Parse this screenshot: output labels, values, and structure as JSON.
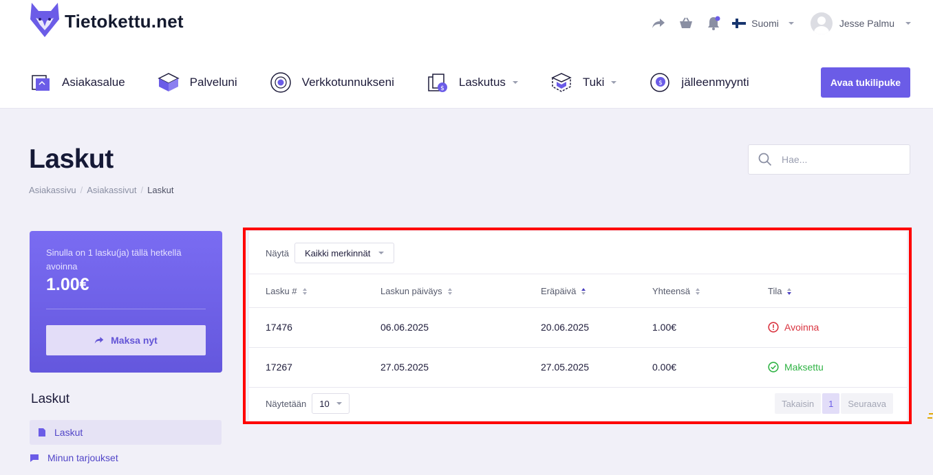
{
  "brand": {
    "name": "Tietokettu.net",
    "accent": "#6b5ce7"
  },
  "top_right": {
    "share_icon": "share-arrow-icon",
    "basket_icon": "basket-icon",
    "bell_icon": "bell-icon",
    "language": "Suomi",
    "user_name": "Jesse Palmu"
  },
  "nav": {
    "items": [
      {
        "label": "Asiakasalue",
        "icon": "client-area-icon",
        "dropdown": false
      },
      {
        "label": "Palveluni",
        "icon": "services-box-icon",
        "dropdown": false
      },
      {
        "label": "Verkkotunnukseni",
        "icon": "domains-globe-icon",
        "dropdown": false
      },
      {
        "label": "Laskutus",
        "icon": "billing-icon",
        "dropdown": true
      },
      {
        "label": "Tuki",
        "icon": "support-box-icon",
        "dropdown": true
      },
      {
        "label": "jälleenmyynti",
        "icon": "reseller-icon",
        "dropdown": false
      }
    ],
    "ticket_button": "Avaa tukilipuke"
  },
  "page": {
    "title": "Laskut",
    "breadcrumb": [
      "Asiakassivu",
      "Asiakassivut",
      "Laskut"
    ],
    "search_placeholder": "Hae..."
  },
  "due_card": {
    "text": "Sinulla on 1 lasku(ja) tällä hetkellä avoinna",
    "amount": "1.00€",
    "pay_button": "Maksa nyt"
  },
  "sidebar": {
    "heading": "Laskut",
    "links": [
      {
        "label": "Laskut",
        "icon": "document-icon",
        "active": true
      },
      {
        "label": "Minun tarjoukset",
        "icon": "chat-icon",
        "active": false
      }
    ]
  },
  "invoices": {
    "filter_label": "Näytä",
    "filter_value": "Kaikki merkinnät",
    "columns": [
      "Lasku #",
      "Laskun päiväys",
      "Eräpäivä",
      "Yhteensä",
      "Tila"
    ],
    "sorted_column": "Eräpäivä",
    "rows": [
      {
        "number": "17476",
        "date": "06.06.2025",
        "due": "20.06.2025",
        "total": "1.00€",
        "status": "Avoinna",
        "status_color": "#d9333f",
        "status_icon": "alert-circle-icon"
      },
      {
        "number": "17267",
        "date": "27.05.2025",
        "due": "27.05.2025",
        "total": "0.00€",
        "status": "Maksettu",
        "status_color": "#2fb344",
        "status_icon": "check-circle-icon"
      }
    ],
    "show_label": "Näytetään",
    "page_size": "10",
    "pager": {
      "prev": "Takaisin",
      "current": "1",
      "next": "Seuraava"
    }
  }
}
